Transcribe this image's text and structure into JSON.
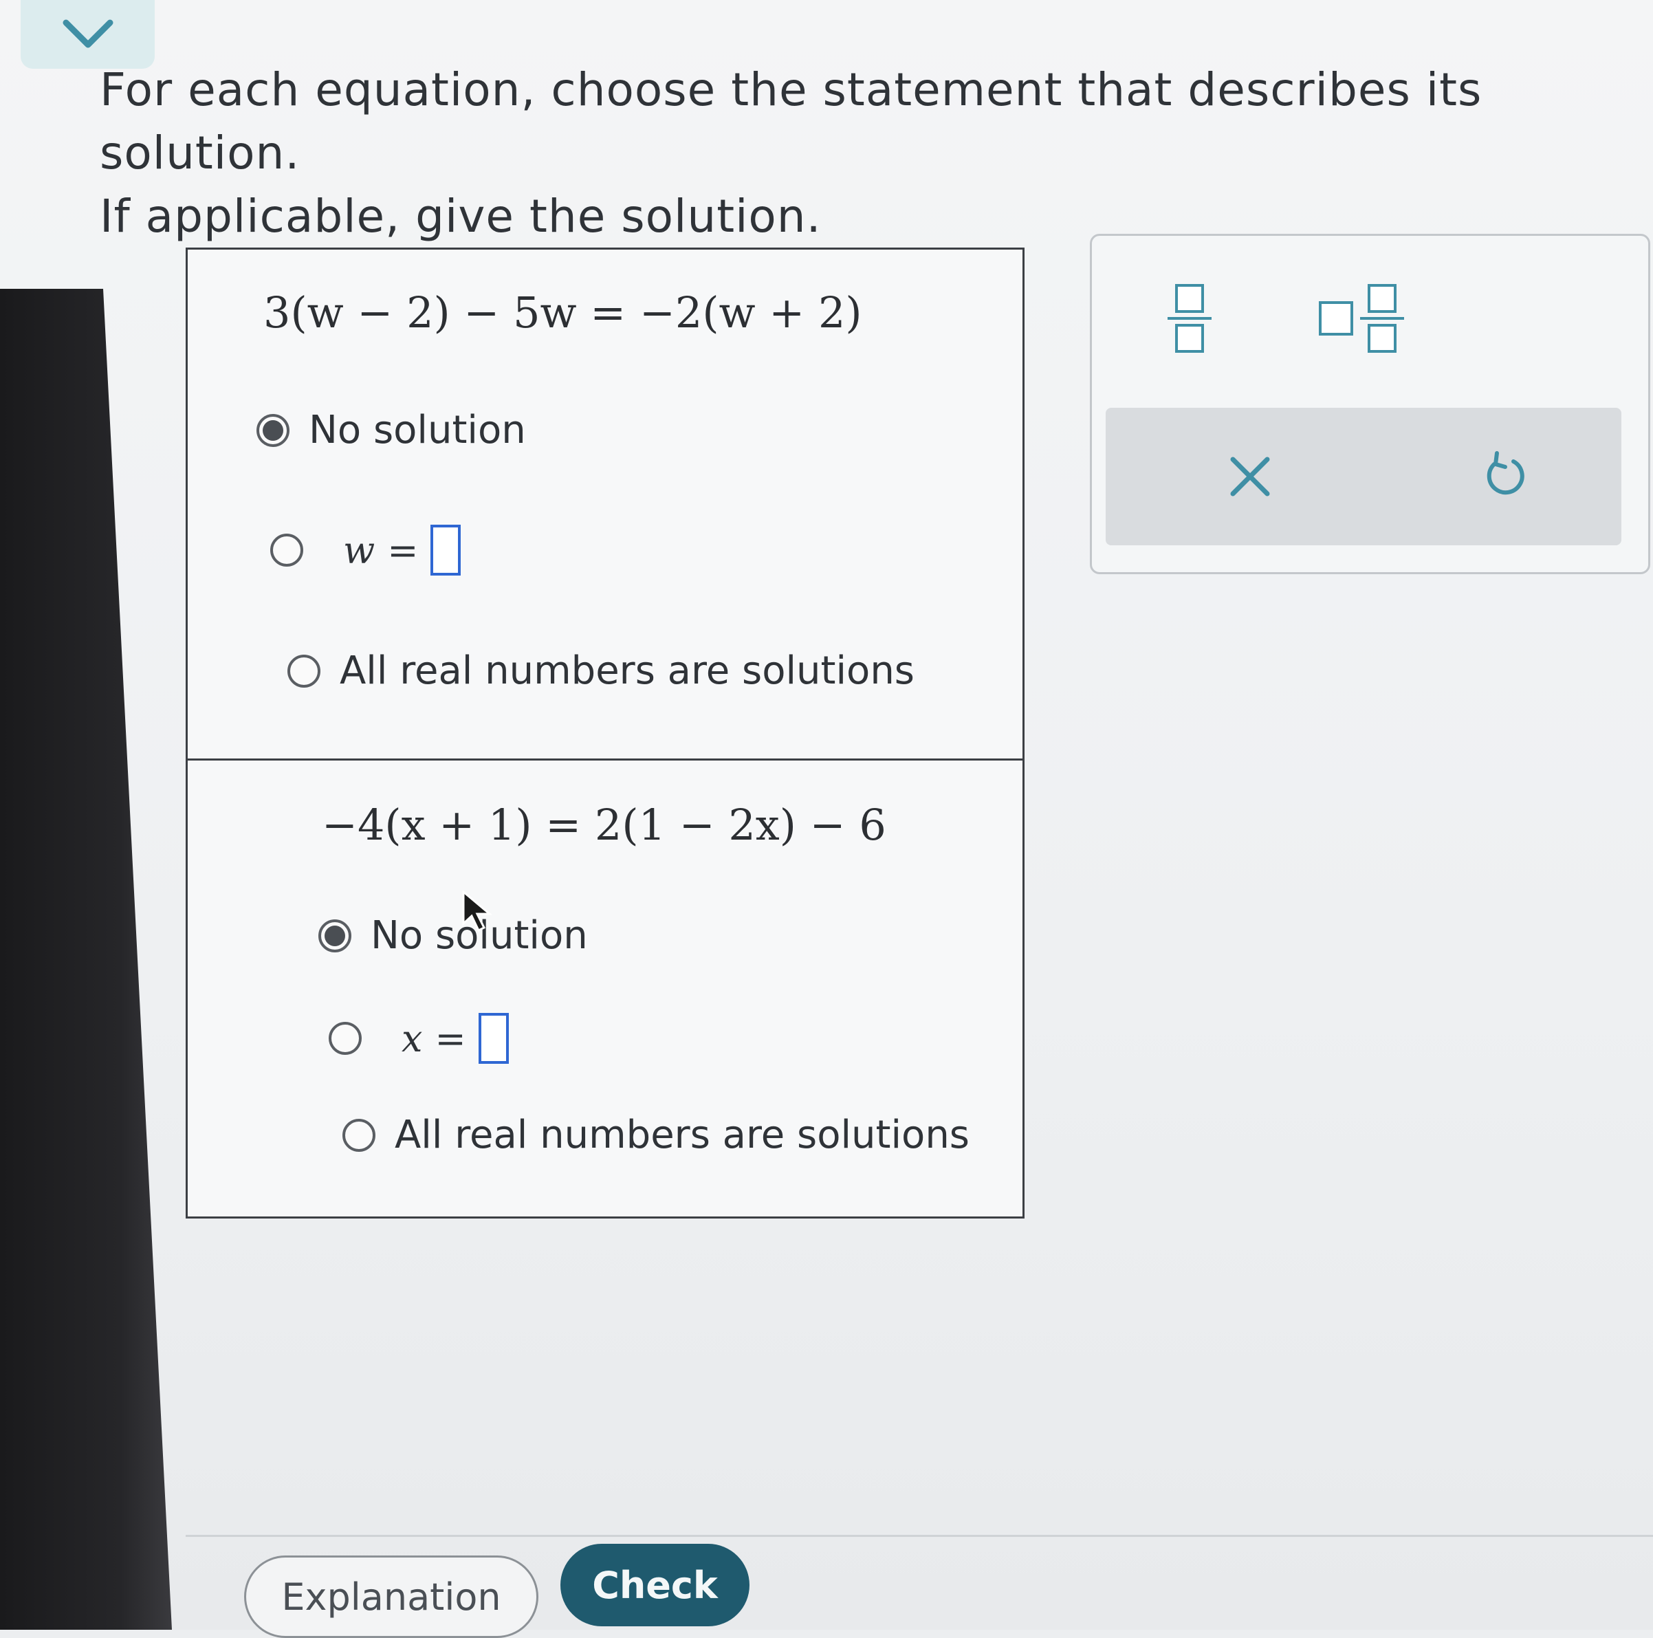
{
  "header": {
    "collapse_icon": "chevron-down-icon",
    "prompt_line1": "For each equation, choose the statement that describes its solution.",
    "prompt_line2": "If applicable, give the solution."
  },
  "problems": [
    {
      "equation": "3(w − 2) − 5w = −2(w + 2)",
      "options": [
        {
          "label": "No solution",
          "checked": true
        },
        {
          "var": "w",
          "eq": "=",
          "checked": false
        },
        {
          "label": "All real numbers are solutions",
          "checked": false
        }
      ]
    },
    {
      "equation": "−4(x + 1) = 2(1 − 2x) − 6",
      "options": [
        {
          "label": "No solution",
          "checked": true
        },
        {
          "var": "x",
          "eq": "=",
          "checked": false
        },
        {
          "label": "All real numbers are solutions",
          "checked": false
        }
      ]
    }
  ],
  "toolbar": {
    "fraction_icon": "fraction-icon",
    "mixed_number_icon": "mixed-number-icon",
    "clear_icon": "close-icon",
    "undo_icon": "undo-icon"
  },
  "footer": {
    "explanation_label": "Explanation",
    "check_label": "Check"
  },
  "colors": {
    "check_button": "#1f5a6e",
    "answer_box_border": "#2f67d3",
    "tool_icon": "#3f8fa5"
  }
}
